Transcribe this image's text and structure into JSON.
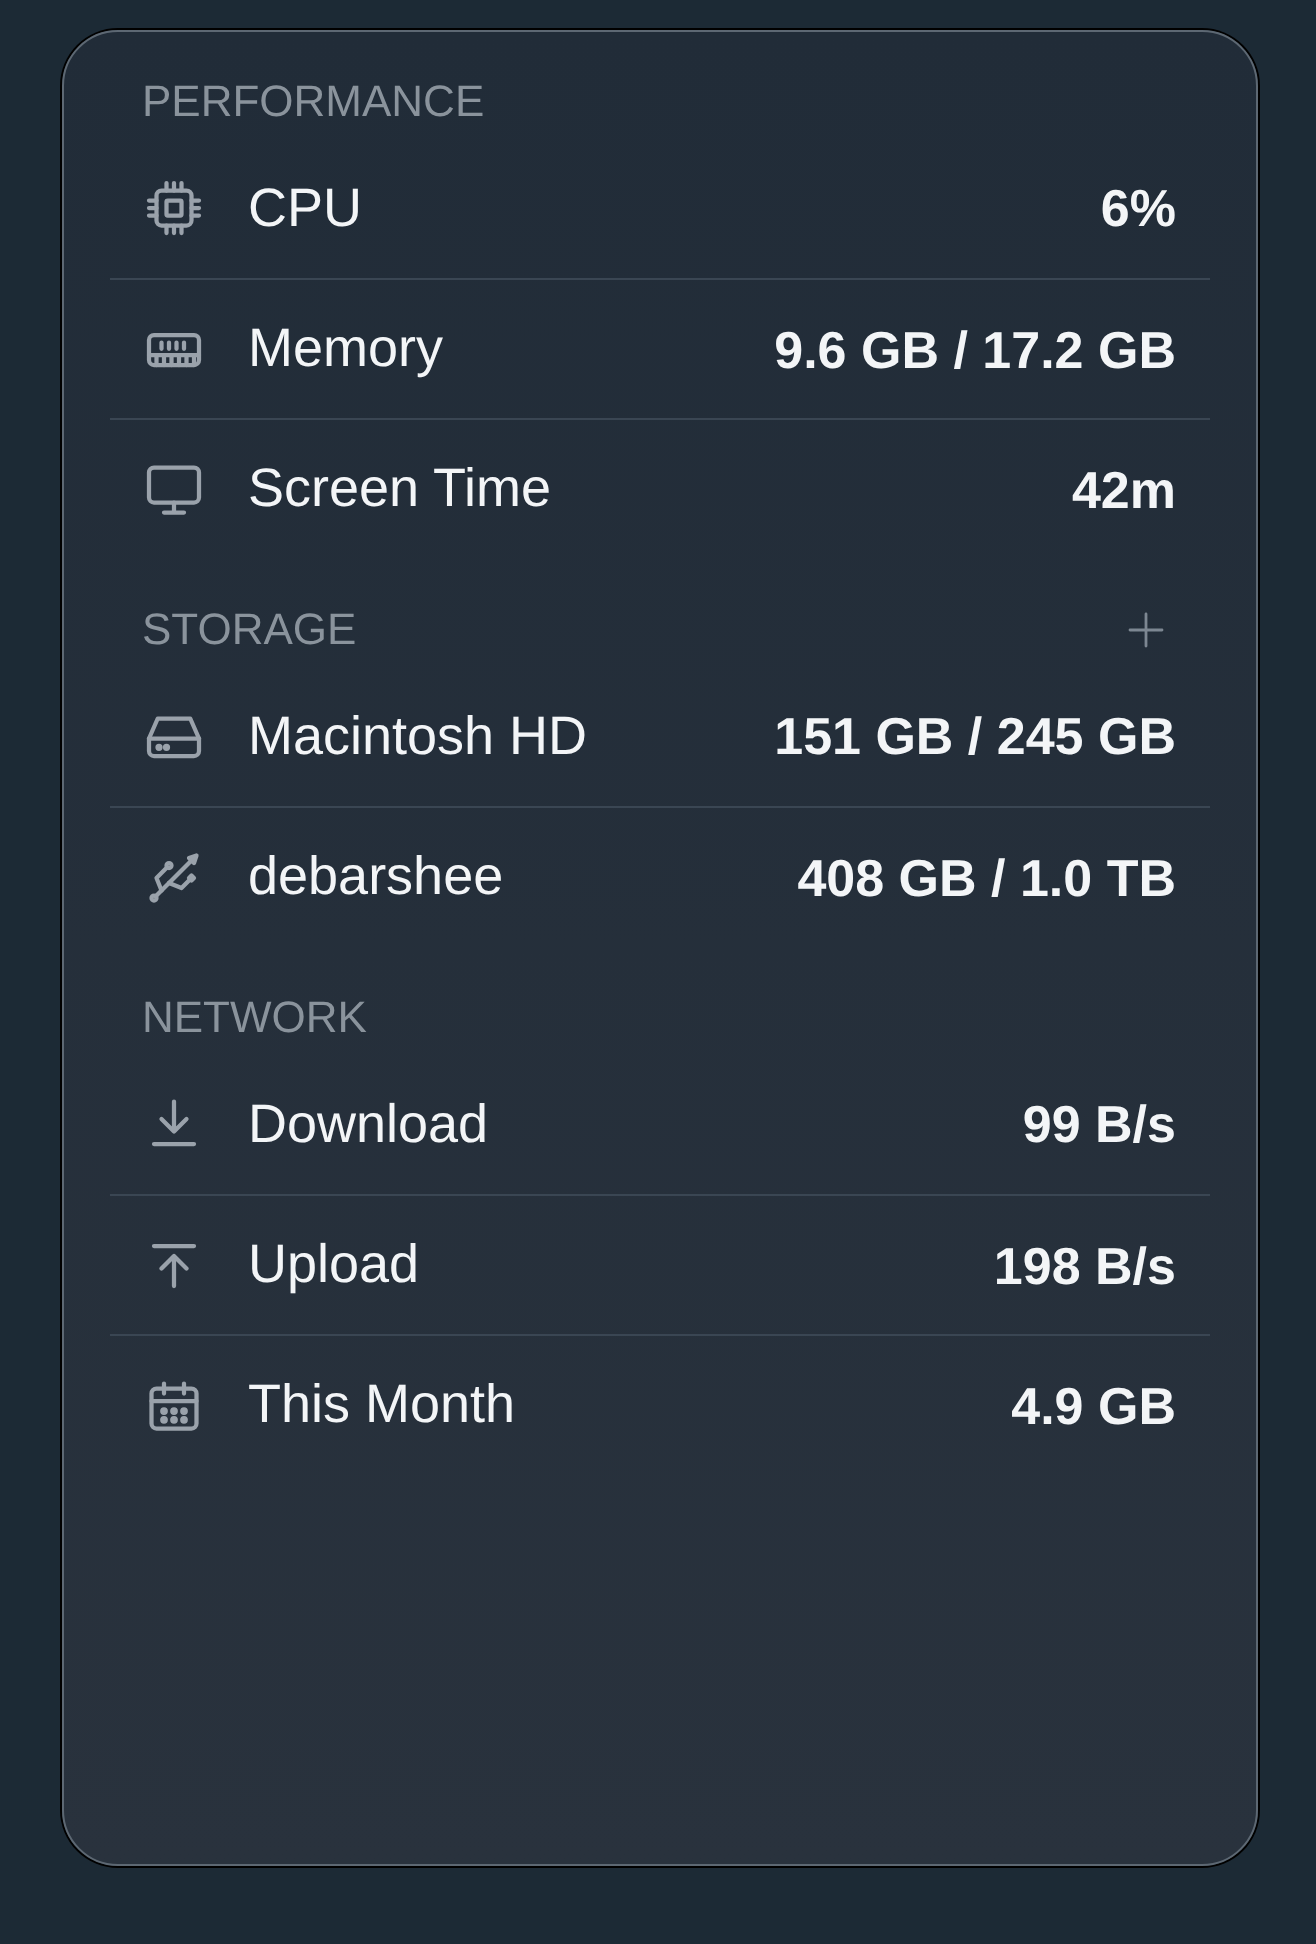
{
  "sections": [
    {
      "title": "PERFORMANCE",
      "rows": [
        {
          "kind": "cpu",
          "label": "CPU",
          "value": "6%"
        },
        {
          "kind": "memory",
          "label": "Memory",
          "value": "9.6 GB / 17.2 GB"
        },
        {
          "kind": "screen_time",
          "label": "Screen Time",
          "value": "42m"
        }
      ]
    },
    {
      "title": "STORAGE",
      "has_add_button": true,
      "rows": [
        {
          "kind": "internal_disk",
          "label": "Macintosh HD",
          "value": "151 GB / 245 GB"
        },
        {
          "kind": "external_disk",
          "label": "debarshee",
          "value": "408 GB / 1.0 TB"
        }
      ]
    },
    {
      "title": "NETWORK",
      "rows": [
        {
          "kind": "download",
          "label": "Download",
          "value": "99 B/s"
        },
        {
          "kind": "upload",
          "label": "Upload",
          "value": "198 B/s"
        },
        {
          "kind": "monthly_usage",
          "label": "This Month",
          "value": "4.9 GB"
        }
      ]
    }
  ]
}
